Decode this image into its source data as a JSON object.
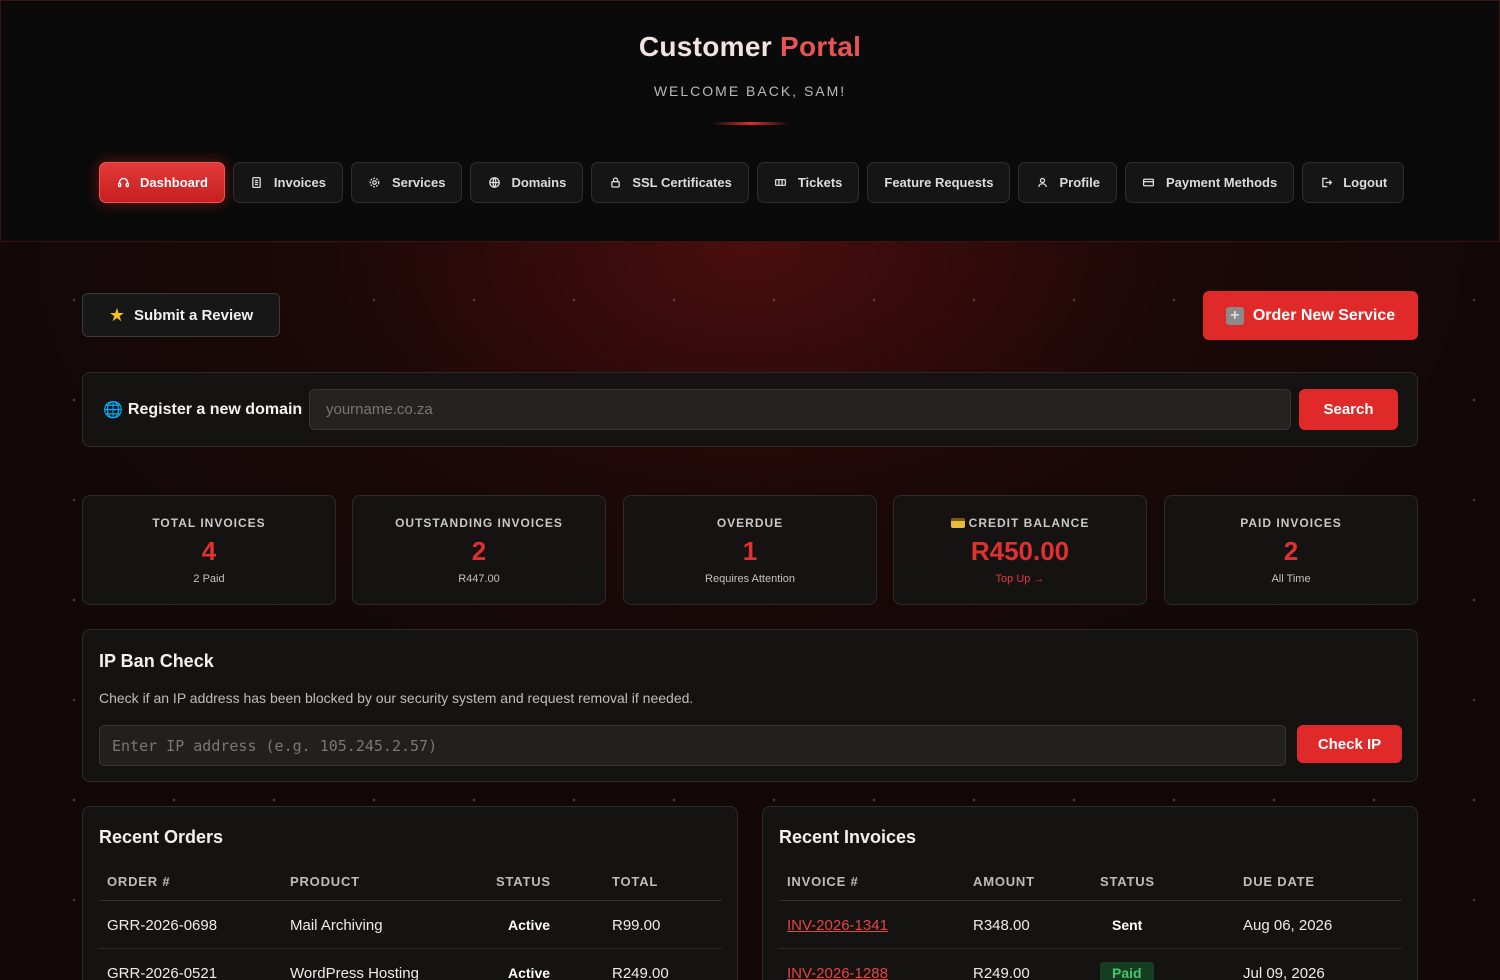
{
  "header": {
    "title_part1": "Customer",
    "title_part2": "Portal",
    "subtitle": "WELCOME BACK, SAM!"
  },
  "nav": [
    {
      "label": "Dashboard",
      "icon": "headset-icon",
      "active": true
    },
    {
      "label": "Invoices",
      "icon": "document-icon"
    },
    {
      "label": "Services",
      "icon": "gear-icon"
    },
    {
      "label": "Domains",
      "icon": "globe-icon"
    },
    {
      "label": "SSL Certificates",
      "icon": "lock-icon"
    },
    {
      "label": "Tickets",
      "icon": "ticket-icon"
    },
    {
      "label": "Feature Requests",
      "icon": ""
    },
    {
      "label": "Profile",
      "icon": "user-icon"
    },
    {
      "label": "Payment Methods",
      "icon": "credit-card-icon"
    },
    {
      "label": "Logout",
      "icon": "logout-icon"
    }
  ],
  "actions": {
    "review_label": "Submit a Review",
    "order_label": "Order New Service"
  },
  "domain_search": {
    "label": "Register a new domain",
    "placeholder": "yourname.co.za",
    "button": "Search"
  },
  "stats": [
    {
      "label": "TOTAL INVOICES",
      "value": "4",
      "sub": "2 Paid"
    },
    {
      "label": "OUTSTANDING INVOICES",
      "value": "2",
      "sub": "R447.00"
    },
    {
      "label": "OVERDUE",
      "value": "1",
      "sub": "Requires Attention"
    },
    {
      "label": "CREDIT BALANCE",
      "value": "R450.00",
      "sub": "Top Up →"
    },
    {
      "label": "PAID INVOICES",
      "value": "2",
      "sub": "All Time"
    }
  ],
  "ip_ban": {
    "title": "IP Ban Check",
    "description": "Check if an IP address has been blocked by our security system and request removal if needed.",
    "placeholder": "Enter IP address (e.g. 105.245.2.57)",
    "button": "Check IP"
  },
  "recent_orders": {
    "title": "Recent Orders",
    "columns": [
      "ORDER #",
      "PRODUCT",
      "STATUS",
      "TOTAL"
    ],
    "rows": [
      {
        "order": "GRR-2026-0698",
        "product": "Mail Archiving",
        "status": "Active",
        "total": "R99.00"
      },
      {
        "order": "GRR-2026-0521",
        "product": "WordPress Hosting",
        "status": "Active",
        "total": "R249.00"
      }
    ]
  },
  "recent_invoices": {
    "title": "Recent Invoices",
    "columns": [
      "INVOICE #",
      "AMOUNT",
      "STATUS",
      "DUE DATE"
    ],
    "rows": [
      {
        "invoice": "INV-2026-1341",
        "amount": "R348.00",
        "status": "Sent",
        "due": "Aug 06, 2026"
      },
      {
        "invoice": "INV-2026-1288",
        "amount": "R249.00",
        "status": "Paid",
        "due": "Jul 09, 2026"
      }
    ]
  },
  "colors": {
    "accent": "#e02a2a",
    "stat_value": "#e23030",
    "paid_badge_bg": "#163d22",
    "paid_badge_text": "#4cc36a"
  }
}
